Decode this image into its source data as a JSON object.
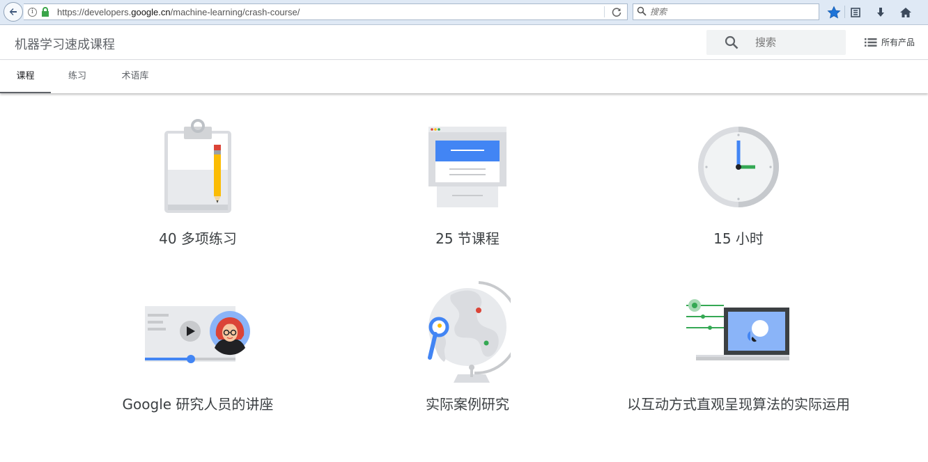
{
  "browser": {
    "url_prefix": "https://developers.",
    "url_domain": "google.cn",
    "url_suffix": "/machine-learning/crash-course/",
    "search_placeholder": "搜索"
  },
  "header": {
    "title": "机器学习速成课程",
    "search_placeholder": "搜索",
    "all_products": "所有产品"
  },
  "tabs": [
    {
      "label": "课程",
      "active": true
    },
    {
      "label": "练习",
      "active": false
    },
    {
      "label": "术语库",
      "active": false
    }
  ],
  "features": [
    {
      "caption": "40 多项练习",
      "icon": "clipboard-pencil-icon"
    },
    {
      "caption": "25 节课程",
      "icon": "lesson-pages-icon"
    },
    {
      "caption": "15 小时",
      "icon": "clock-icon"
    },
    {
      "caption": "Google 研究人员的讲座",
      "icon": "video-lecture-icon"
    },
    {
      "caption": "实际案例研究",
      "icon": "globe-magnifier-icon"
    },
    {
      "caption": "以互动方式直观呈现算法的实际运用",
      "icon": "laptop-sliders-icon"
    }
  ],
  "colors": {
    "accent_blue": "#4285f4",
    "accent_green": "#34a853",
    "accent_red": "#db4437",
    "accent_yellow": "#fbbc04"
  }
}
